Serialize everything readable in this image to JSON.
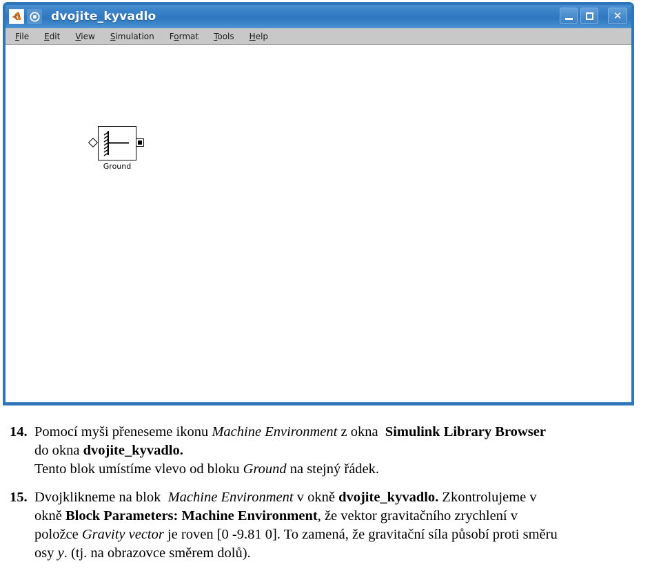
{
  "window": {
    "title": "dvojite_kyvadlo",
    "icons": {
      "app": "matlab-icon",
      "doc": "simulink-icon"
    },
    "controls": {
      "minimize": "minimize-icon",
      "maximize": "maximize-icon",
      "close": "close-icon"
    },
    "menus": [
      {
        "label": "File",
        "mnemonic": "F",
        "pre": "",
        "post": "ile"
      },
      {
        "label": "Edit",
        "mnemonic": "E",
        "pre": "",
        "post": "dit"
      },
      {
        "label": "View",
        "mnemonic": "V",
        "pre": "",
        "post": "iew"
      },
      {
        "label": "Simulation",
        "mnemonic": "S",
        "pre": "",
        "post": "imulation"
      },
      {
        "label": "Format",
        "mnemonic": "o",
        "pre": "F",
        "post": "rmat"
      },
      {
        "label": "Tools",
        "mnemonic": "T",
        "pre": "",
        "post": "ools"
      },
      {
        "label": "Help",
        "mnemonic": "H",
        "pre": "",
        "post": "elp"
      }
    ],
    "blocks": [
      {
        "name": "Ground",
        "label": "Ground"
      }
    ]
  },
  "document": {
    "items": [
      {
        "number": "14.",
        "lines": [
          [
            {
              "t": "Pomocí myši přeneseme ikonu ",
              "s": "normal"
            },
            {
              "t": "Machine Environment",
              "s": "italic"
            },
            {
              "t": " z okna  ",
              "s": "normal"
            },
            {
              "t": "Simulink Library Browser",
              "s": "bold"
            }
          ],
          [
            {
              "t": "do okna ",
              "s": "normal"
            },
            {
              "t": "dvojite_kyvadlo.",
              "s": "bold"
            }
          ],
          [
            {
              "t": "Tento blok umístíme vlevo od bloku ",
              "s": "normal"
            },
            {
              "t": "Ground",
              "s": "italic"
            },
            {
              "t": " na stejný řádek.",
              "s": "normal"
            }
          ]
        ]
      },
      {
        "number": "15.",
        "lines": [
          [
            {
              "t": "Dvojklikneme na blok  ",
              "s": "normal"
            },
            {
              "t": "Machine Environment",
              "s": "italic"
            },
            {
              "t": " v okně ",
              "s": "normal"
            },
            {
              "t": "dvojite_kyvadlo.",
              "s": "bold"
            },
            {
              "t": " Zkontrolujeme v",
              "s": "normal"
            }
          ],
          [
            {
              "t": "okně ",
              "s": "normal"
            },
            {
              "t": "Block Parameters: Machine Environment",
              "s": "bold"
            },
            {
              "t": ", že vektor gravitačního zrychlení v",
              "s": "normal"
            }
          ],
          [
            {
              "t": "položce ",
              "s": "normal"
            },
            {
              "t": "Gravity vector",
              "s": "italic"
            },
            {
              "t": " je roven [0 -9.81 0]. To zamená, že gravitační síla působí proti směru",
              "s": "normal"
            }
          ],
          [
            {
              "t": "osy ",
              "s": "normal"
            },
            {
              "t": "y",
              "s": "italic"
            },
            {
              "t": ". (tj. na obrazovce směrem dolů).",
              "s": "normal"
            }
          ]
        ]
      }
    ]
  },
  "colors": {
    "title_bar": "#3c84c9",
    "window_border": "#2f76b8",
    "menubar": "#c8c8c8",
    "canvas": "#ffffff",
    "text": "#000000"
  }
}
